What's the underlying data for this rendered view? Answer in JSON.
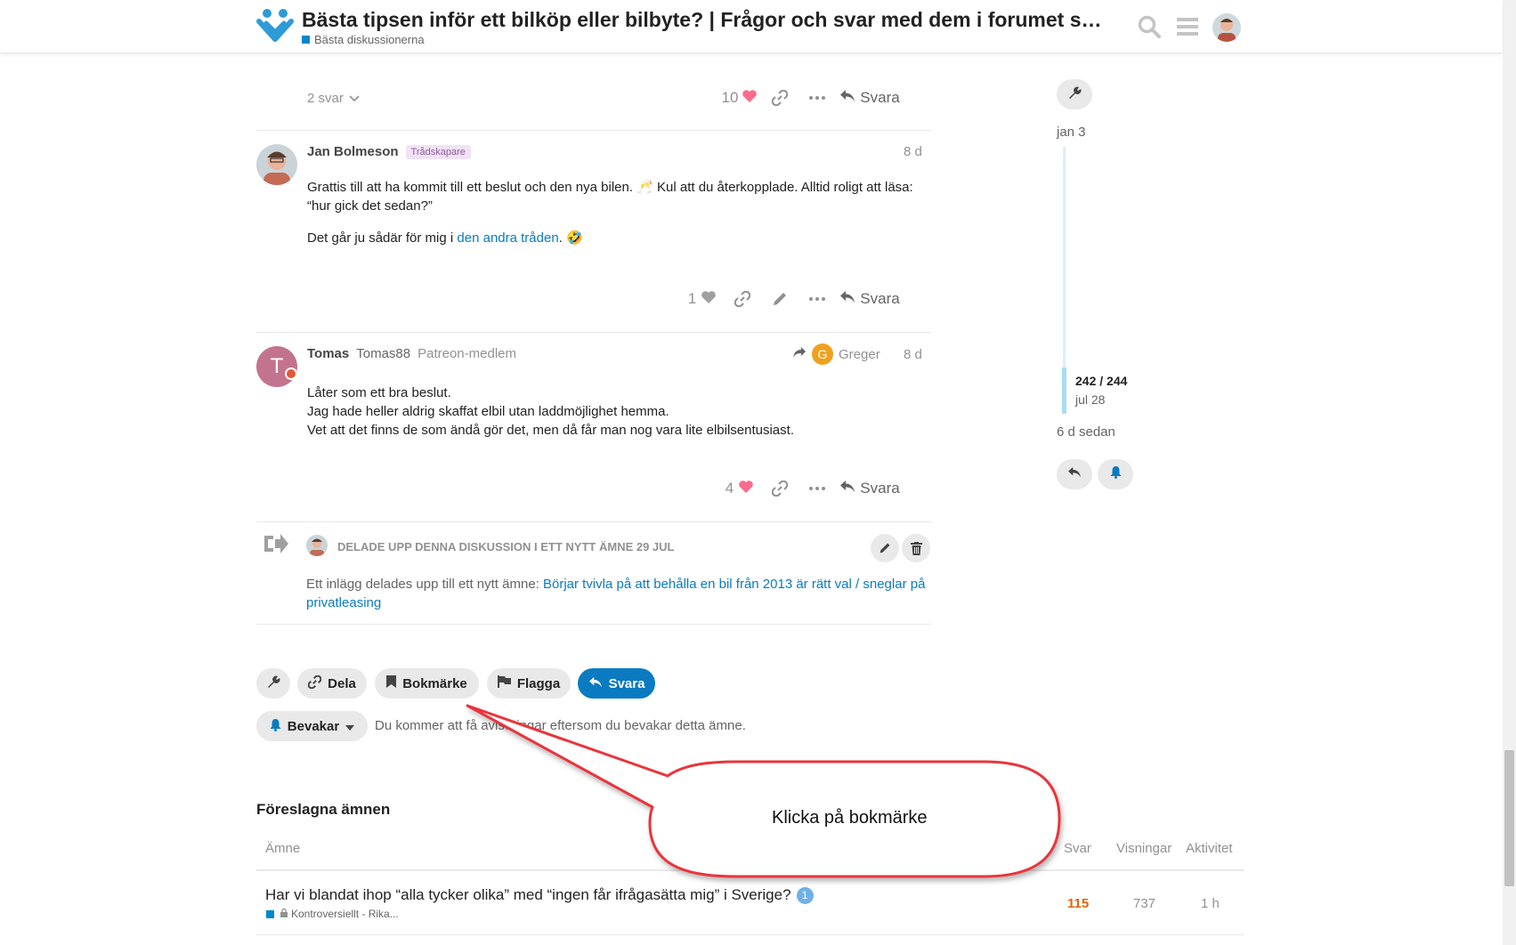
{
  "header": {
    "title": "Bästa tipsen inför ett bilköp eller bilbyte? | Frågor och svar med dem i forumet so…",
    "category": "Bästa diskussionerna"
  },
  "post1": {
    "replies": "2 svar",
    "likes": "10",
    "reply_label": "Svara"
  },
  "post2": {
    "author": "Jan Bolmeson",
    "badge": "Trådskapare",
    "date": "8 d",
    "line1": "Grattis till att ha kommit till ett beslut och den nya bilen. 🥂 Kul att du återkopplade. Alltid roligt att läsa: “hur gick det sedan?”",
    "line2_prefix": "Det går ju sådär för mig i ",
    "line2_link": "den andra tråden",
    "line2_suffix": ". 🤣",
    "likes": "1",
    "reply_label": "Svara"
  },
  "post3": {
    "author": "Tomas",
    "username": "Tomas88",
    "title": "Patreon-medlem",
    "avatar_letter": "T",
    "reply_to_letter": "G",
    "reply_to": "Greger",
    "date": "8 d",
    "line1": "Låter som ett bra beslut.",
    "line2": "Jag hade heller aldrig skaffat elbil utan laddmöjlighet hemma.",
    "line3": "Vet att det finns de som ändå gör det, men då får man nog vara lite elbilsentusiast.",
    "likes": "4",
    "reply_label": "Svara"
  },
  "small_action": {
    "text": "DELADE UPP DENNA DISKUSSION I ETT NYTT ÄMNE 29 JUL",
    "body_prefix": "Ett inlägg delades upp till ett nytt ämne: ",
    "body_link": "Börjar tvivla på att behålla en bil från 2013 är rätt val / sneglar på privatleasing"
  },
  "footer_buttons": {
    "share": "Dela",
    "bookmark": "Bokmärke",
    "flag": "Flagga",
    "reply": "Svara"
  },
  "notifications": {
    "level": "Bevakar",
    "description": "Du kommer att få aviseringar eftersom du bevakar detta ämne."
  },
  "timeline": {
    "start_date": "jan 3",
    "position": "242 / 244",
    "position_date": "jul 28",
    "last_activity": "6 d sedan"
  },
  "suggested": {
    "heading": "Föreslagna ämnen",
    "columns": {
      "topic": "Ämne",
      "replies": "Svar",
      "views": "Visningar",
      "activity": "Aktivitet"
    },
    "rows": [
      {
        "title": "Har vi blandat ihop “alla tycker olika” med “ingen får ifrågasätta mig” i Sverige?",
        "unread": "1",
        "category": "Kontroversiellt - Rika...",
        "replies": "115",
        "views": "737",
        "activity": "1 h"
      }
    ]
  },
  "annotation": {
    "text": "Klicka på bokmärke"
  },
  "colors": {
    "accent": "#0a7bc1",
    "heart": "#fa6c8d",
    "callout_stroke": "#e8363c",
    "hot_replies": "#e36209"
  }
}
